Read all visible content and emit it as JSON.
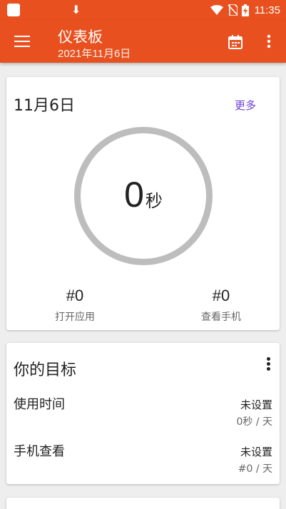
{
  "status_bar": {
    "time": "11:35"
  },
  "app_bar": {
    "title": "仪表板",
    "subtitle": "2021年11月6日",
    "icons": [
      "menu-icon",
      "calendar-icon",
      "more-vert-icon"
    ]
  },
  "summary_card": {
    "date": "11月6日",
    "more_label": "更多",
    "ring_value": "0",
    "ring_unit": "秒",
    "stats": [
      {
        "value": "#0",
        "label": "打开应用"
      },
      {
        "value": "#0",
        "label": "查看手机"
      }
    ]
  },
  "goals_card": {
    "title": "你的目标",
    "items": [
      {
        "name": "使用时间",
        "status": "未设置",
        "limit": "0秒 / 天"
      },
      {
        "name": "手机查看",
        "status": "未设置",
        "limit": "#0 / 天"
      }
    ]
  },
  "colors": {
    "primary": "#e8511f",
    "accent_link": "#6a3fd9",
    "ring": "#bdbdbd",
    "background": "#eeeeee"
  }
}
